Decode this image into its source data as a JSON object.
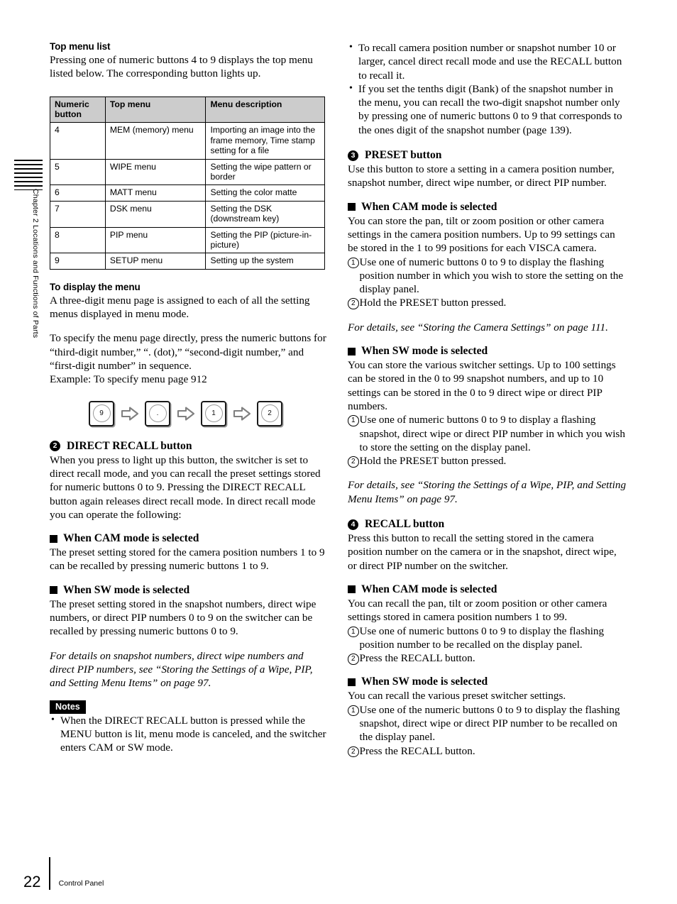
{
  "chapter_tab": {
    "label": "Chapter 2  Locations and Functions of Parts",
    "rule_count": 8
  },
  "left_column": {
    "top_menu_list": {
      "heading": "Top menu list",
      "intro": "Pressing one of numeric buttons 4 to 9 displays the top menu listed below. The corresponding button lights up."
    },
    "table": {
      "headers": [
        "Numeric button",
        "Top menu",
        "Menu description"
      ],
      "rows": [
        [
          "4",
          "MEM (memory) menu",
          "Importing an image into the frame memory, Time stamp setting for a file"
        ],
        [
          "5",
          "WIPE menu",
          "Setting the wipe pattern or border"
        ],
        [
          "6",
          "MATT menu",
          "Setting the color matte"
        ],
        [
          "7",
          "DSK menu",
          "Setting the DSK (downstream key)"
        ],
        [
          "8",
          "PIP menu",
          "Setting the PIP (picture-in-picture)"
        ],
        [
          "9",
          "SETUP menu",
          "Setting up the system"
        ]
      ]
    },
    "display_menu": {
      "heading": "To display the menu",
      "para1": "A three-digit menu page is assigned to each of all the setting menus displayed in menu mode.",
      "para2": "To specify the menu page directly, press the numeric buttons for “third-digit number,” “. (dot),” “second-digit number,” and “first-digit number” in sequence.",
      "example": "Example: To specify menu page 912"
    },
    "key_sequence": {
      "keys": [
        "9",
        ".",
        "1",
        "2"
      ],
      "arrow_icon": "right-arrow-icon"
    },
    "direct_recall": {
      "marker": "2",
      "heading": "DIRECT RECALL button",
      "body": "When you press to light up this button, the switcher is set to direct recall mode, and you can recall the preset settings stored for numeric buttons 0 to 9. Pressing the DIRECT RECALL button again releases direct recall mode. In direct recall mode you can operate the following:",
      "cam": {
        "heading": "When CAM mode is selected",
        "body": "The preset setting stored for the camera position numbers 1 to 9 can be recalled by pressing numeric buttons 1 to 9."
      },
      "sw": {
        "heading": "When SW mode is selected",
        "body": "The preset setting stored in the snapshot numbers, direct wipe numbers, or direct PIP numbers 0 to 9 on the switcher can be recalled by pressing numeric buttons 0 to 9."
      },
      "cross_ref": "For details on snapshot numbers, direct wipe numbers and direct PIP numbers, see “Storing the Settings of a Wipe, PIP, and Setting Menu Items” on page 97."
    },
    "notes": {
      "tag": "Notes",
      "items": [
        "When the DIRECT RECALL button is pressed while the MENU button is lit, menu mode is canceled, and the switcher enters CAM or SW mode."
      ]
    }
  },
  "right_column": {
    "top_bullets": [
      "To recall camera position number or snapshot number 10 or larger, cancel direct recall mode and use the RECALL button to recall it.",
      "If you set the tenths digit (Bank) of the snapshot number in the menu, you can recall the two-digit snapshot number only by pressing one of numeric buttons 0 to 9 that corresponds to the ones digit of the snapshot number (page 139)."
    ],
    "preset": {
      "marker": "3",
      "heading": "PRESET button",
      "body": "Use this button to store a setting in a camera position number, snapshot number, direct wipe number, or direct PIP number.",
      "cam": {
        "heading": "When CAM mode is selected",
        "body": "You can store the pan, tilt or zoom position or other camera settings in the camera position numbers. Up to 99 settings can be stored in the 1 to 99 positions for each VISCA camera.",
        "steps": [
          {
            "num": "1",
            "text": "Use one of numeric buttons 0 to 9 to display the flashing position number in which you wish to store the setting on the display panel."
          },
          {
            "num": "2",
            "text": "Hold the PRESET button pressed."
          }
        ],
        "cross_ref": "For details, see “Storing the Camera Settings” on page 111."
      },
      "sw": {
        "heading": "When SW mode is selected",
        "body": "You can store the various switcher settings. Up to 100 settings can be stored in the 0 to 99 snapshot numbers, and up to 10 settings can be stored in the 0 to 9 direct wipe or direct PIP numbers.",
        "steps": [
          {
            "num": "1",
            "text": "Use one of numeric buttons 0 to 9 to display a flashing snapshot, direct wipe or direct PIP number in which you wish to store the setting on the display panel."
          },
          {
            "num": "2",
            "text": "Hold the PRESET button pressed."
          }
        ],
        "cross_ref": "For details, see “Storing the Settings of a Wipe, PIP, and Setting Menu Items” on page 97."
      }
    },
    "recall": {
      "marker": "4",
      "heading": "RECALL button",
      "body": "Press this button to recall the setting stored in the camera position number on the camera or in the snapshot, direct wipe, or direct PIP number on the switcher.",
      "cam": {
        "heading": "When CAM mode is selected",
        "body": "You can recall the pan, tilt or zoom position or other camera settings stored in camera position numbers 1 to 99.",
        "steps": [
          {
            "num": "1",
            "text": "Use one of numeric buttons 0 to 9 to display the flashing position number to be recalled on the display panel."
          },
          {
            "num": "2",
            "text": "Press the RECALL button."
          }
        ]
      },
      "sw": {
        "heading": "When SW mode is selected",
        "body": "You can recall the various preset switcher settings.",
        "steps": [
          {
            "num": "1",
            "text": "Use one of the numeric buttons 0 to 9 to display the flashing snapshot, direct wipe or direct PIP number to be recalled on the display panel."
          },
          {
            "num": "2",
            "text": "Press the RECALL button."
          }
        ]
      }
    }
  },
  "footer": {
    "page_number": "22",
    "section": "Control Panel"
  },
  "colors": {
    "table_header_bg": "#cccccc",
    "text": "#000000",
    "arrow_stroke": "#808080",
    "key_border": "#1a1a1a"
  }
}
